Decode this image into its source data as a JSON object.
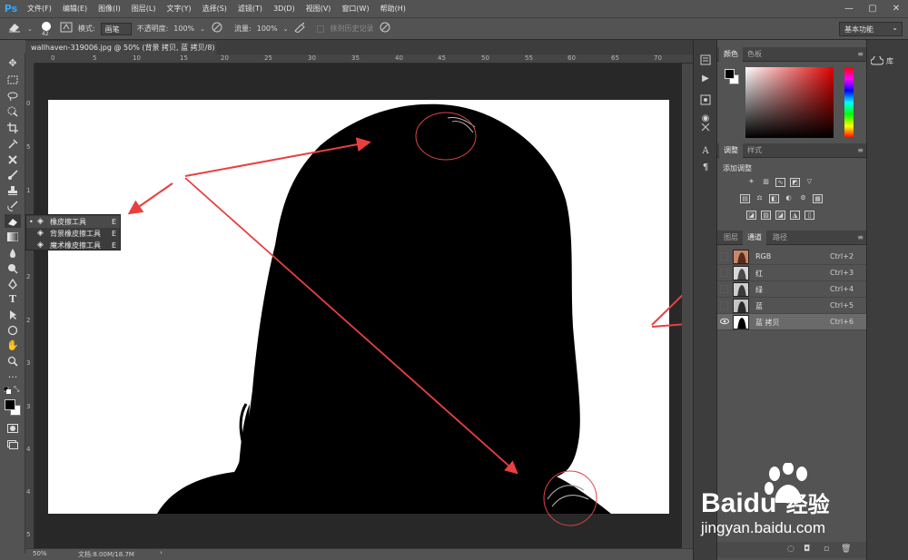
{
  "app": {
    "logo": "Ps",
    "menus": [
      "文件(F)",
      "编辑(E)",
      "图像(I)",
      "图层(L)",
      "文字(Y)",
      "选择(S)",
      "滤镜(T)",
      "3D(D)",
      "视图(V)",
      "窗口(W)",
      "帮助(H)"
    ],
    "window_controls": {
      "minimize": "—",
      "maximize": "▢",
      "close": "✕"
    }
  },
  "options": {
    "brush_size": "42",
    "mode_label": "模式:",
    "mode_value": "画笔",
    "opacity_label": "不透明度:",
    "opacity_value": "100%",
    "flow_label": "流量:",
    "flow_value": "100%",
    "erase_history": "抹到历史记录",
    "workspace": "基本功能"
  },
  "document": {
    "tab_title": "wallhaven-319006.jpg @ 50% (背景 拷贝, 蓝 拷贝/8) *",
    "tab_close": "×",
    "ruler_top": [
      "0",
      "5",
      "10",
      "15",
      "20",
      "25",
      "30",
      "35",
      "40",
      "45",
      "50",
      "55",
      "60",
      "65",
      "70"
    ],
    "ruler_left": [
      "0",
      "5",
      "1",
      "1",
      "2",
      "2",
      "3",
      "3",
      "4",
      "4",
      "5"
    ]
  },
  "status": {
    "zoom": "50%",
    "doc_info": "文档:8.00M/18.7M"
  },
  "flyout": {
    "items": [
      {
        "label": "橡皮擦工具",
        "shortcut": "E",
        "active": true
      },
      {
        "label": "背景橡皮擦工具",
        "shortcut": "E",
        "active": false
      },
      {
        "label": "魔术橡皮擦工具",
        "shortcut": "E",
        "active": false
      }
    ]
  },
  "panels": {
    "color_tabs": [
      "颜色",
      "色板"
    ],
    "adjust_tabs": [
      "调整",
      "样式"
    ],
    "adjust_title": "添加调整",
    "layer_tabs": [
      "图层",
      "通道",
      "路径"
    ],
    "library": "库",
    "channels": [
      {
        "name": "RGB",
        "shortcut": "Ctrl+2",
        "selected": false,
        "visible": false
      },
      {
        "name": "红",
        "shortcut": "Ctrl+3",
        "selected": false,
        "visible": false
      },
      {
        "name": "绿",
        "shortcut": "Ctrl+4",
        "selected": false,
        "visible": false
      },
      {
        "name": "蓝",
        "shortcut": "Ctrl+5",
        "selected": false,
        "visible": false
      },
      {
        "name": "蓝 拷贝",
        "shortcut": "Ctrl+6",
        "selected": true,
        "visible": true
      }
    ]
  },
  "watermark": {
    "brand": "Baidu",
    "brand_cn": "经验",
    "url": "jingyan.baidu.com"
  },
  "colors": {
    "annotation": "#e84040",
    "ps_blue": "#31a8ff",
    "panel_bg": "#535353"
  }
}
